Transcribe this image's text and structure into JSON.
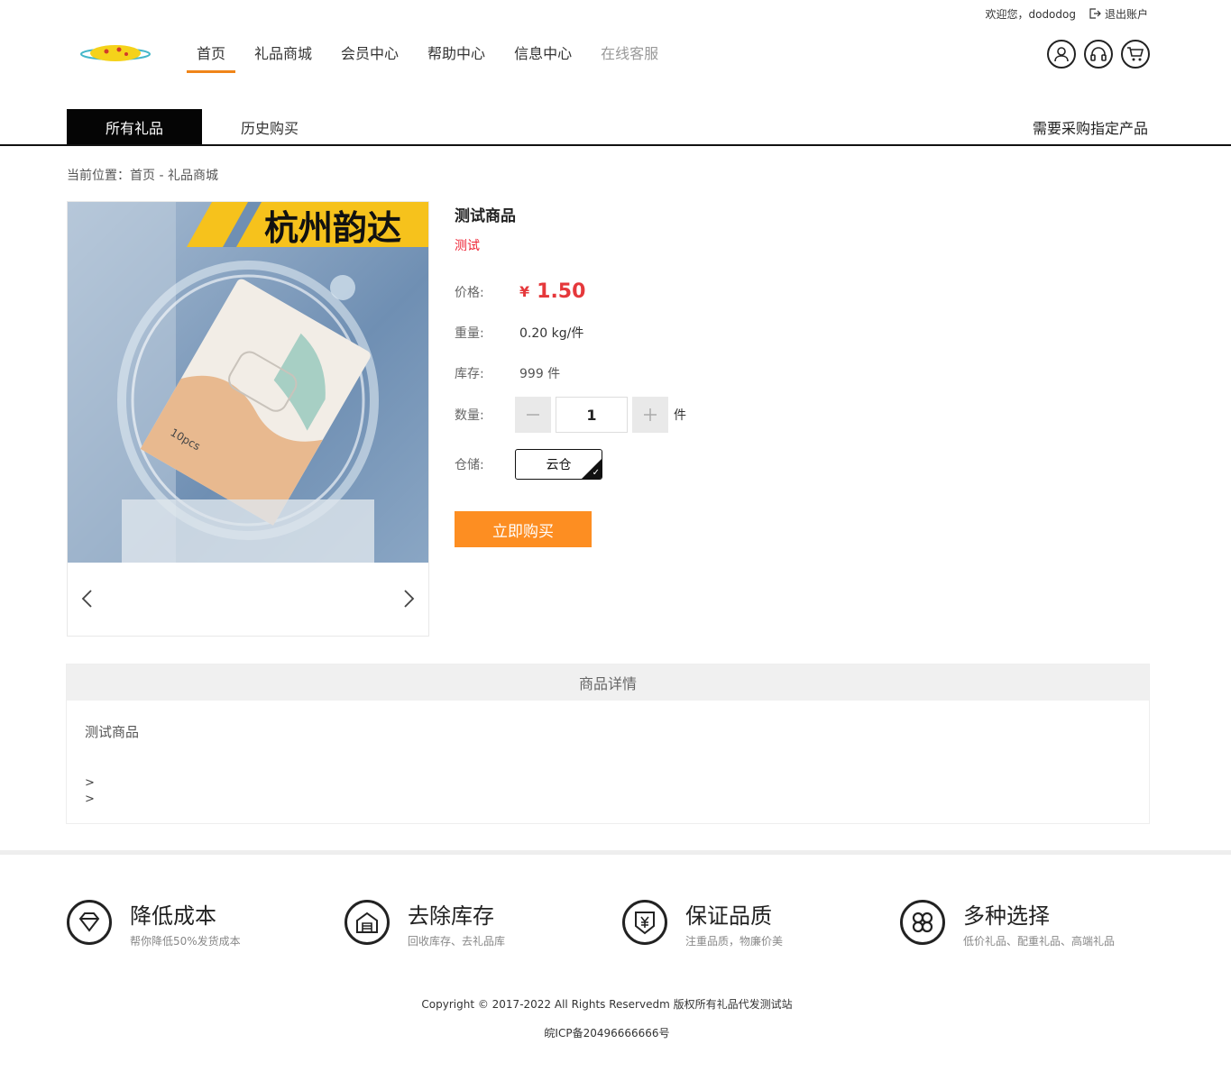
{
  "topbar": {
    "welcome": "欢迎您，dododog",
    "logout": "退出账户"
  },
  "nav": [
    {
      "label": "首页",
      "active": true
    },
    {
      "label": "礼品商城"
    },
    {
      "label": "会员中心"
    },
    {
      "label": "帮助中心"
    },
    {
      "label": "信息中心"
    },
    {
      "label": "在线客服",
      "muted": true
    }
  ],
  "header_icons": [
    "user-icon",
    "headset-icon",
    "cart-icon"
  ],
  "tabs": {
    "all": "所有礼品",
    "history": "历史购买",
    "right": "需要采购指定产品"
  },
  "breadcrumb": "当前位置：首页 - 礼品商城",
  "gallery": {
    "banner_text": "杭州韵达",
    "package_text": "10pcs"
  },
  "product": {
    "title": "测试商品",
    "subtitle": "测试",
    "price_label": "价格:",
    "currency": "¥",
    "price": "1.50",
    "weight_label": "重量:",
    "weight": "0.20 kg/件",
    "stock_label": "库存:",
    "stock": "999 件",
    "qty_label": "数量:",
    "qty": "1",
    "qty_unit": "件",
    "warehouse_label": "仓储:",
    "warehouse": "云仓",
    "buy": "立即购买"
  },
  "detail": {
    "heading": "商品详情",
    "text": "测试商品",
    "line1": ">",
    "line2": ">"
  },
  "features": [
    {
      "icon": "diamond-icon",
      "title": "降低成本",
      "desc": "帮你降低50%发货成本"
    },
    {
      "icon": "warehouse-icon",
      "title": "去除库存",
      "desc": "回收库存、去礼品库"
    },
    {
      "icon": "yen-shield-icon",
      "title": "保证品质",
      "desc": "注重品质，物廉价美"
    },
    {
      "icon": "grid-options-icon",
      "title": "多种选择",
      "desc": "低价礼品、配重礼品、高端礼品"
    }
  ],
  "footer": {
    "copyright": "Copyright © 2017-2022 All Rights Reservedm 版权所有礼品代发测试站",
    "icp": "皖ICP备20496666666号"
  }
}
